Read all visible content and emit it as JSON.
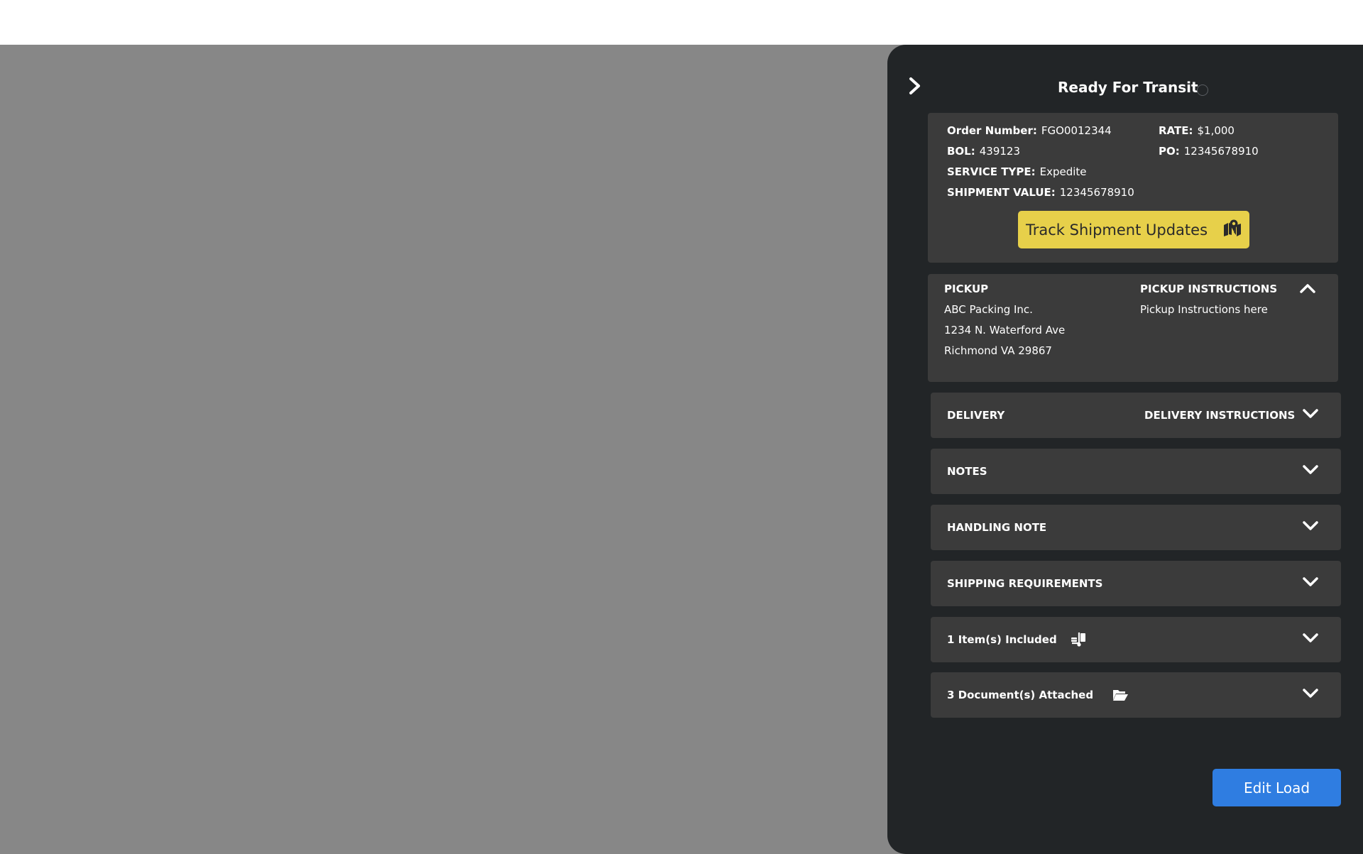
{
  "panel": {
    "status_title": "Ready For Transit",
    "order": {
      "order_number_label": "Order Number:",
      "order_number": "FGO0012344",
      "bol_label": "BOL:",
      "bol": "439123",
      "service_type_label": "SERVICE TYPE:",
      "service_type": "Expedite",
      "shipment_value_label": "SHIPMENT VALUE:",
      "shipment_value": "12345678910",
      "rate_label": "RATE:",
      "rate": "$1,000",
      "po_label": "PO:",
      "po": "12345678910"
    },
    "track_button_label": "Track Shipment Updates",
    "pickup": {
      "heading": "PICKUP",
      "name": "ABC Packing Inc.",
      "address_line1": "1234 N. Waterford Ave",
      "address_line2": "Richmond VA 29867",
      "instructions_heading": "PICKUP INSTRUCTIONS",
      "instructions": "Pickup Instructions here"
    },
    "sections": {
      "delivery": "DELIVERY",
      "delivery_instructions": "DELIVERY INSTRUCTIONS",
      "notes": "NOTES",
      "handling_note": "HANDLING NOTE",
      "shipping_requirements": "SHIPPING REQUIREMENTS",
      "items_included": "1 Item(s) Included",
      "documents_attached": "3 Document(s) Attached"
    },
    "edit_button_label": "Edit Load"
  },
  "icons": {
    "collapse": "chevron-right-icon",
    "track": "map-marker-icon",
    "items": "hand-truck-icon",
    "documents": "folder-open-icon",
    "expand": "chevron-down-icon",
    "collapse_section": "chevron-up-icon"
  },
  "colors": {
    "panel_bg": "#222527",
    "card_bg": "#3b3b3b",
    "track_button": "#e7d04a",
    "edit_button": "#2f7de1",
    "overlay": "#878787"
  }
}
